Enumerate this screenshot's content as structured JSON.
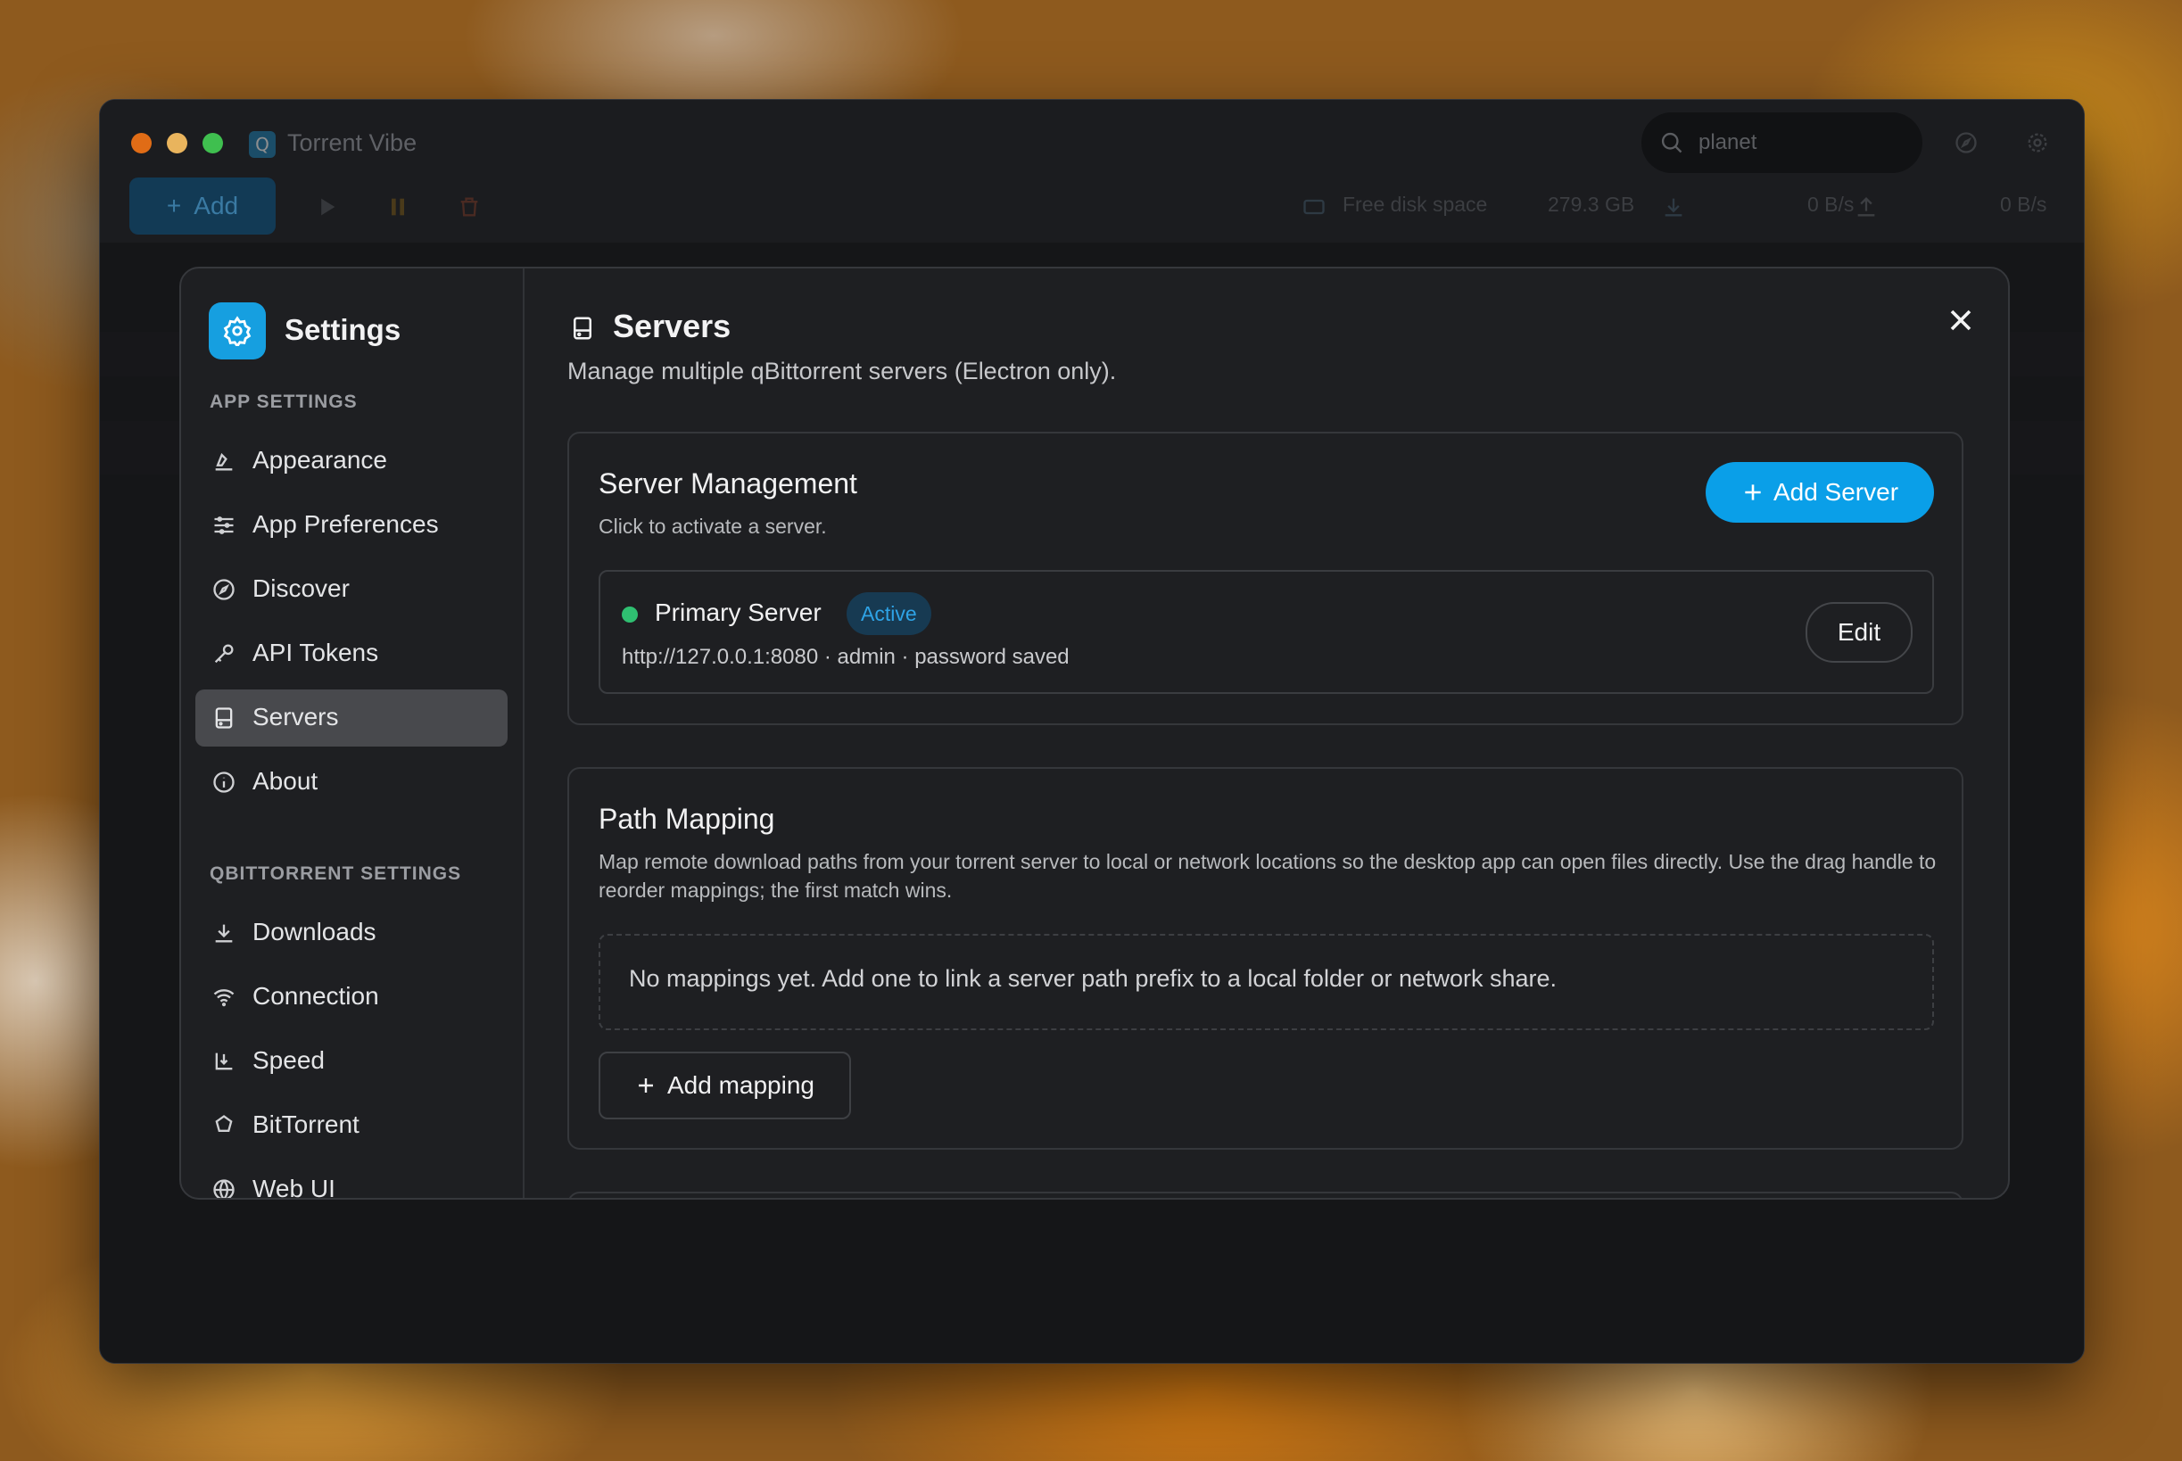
{
  "app": {
    "title": "Torrent Vibe",
    "search_value": "planet",
    "add_label": "Add",
    "free_disk_label": "Free disk space",
    "free_disk_value": "279.3 GB",
    "download_speed": "0 B/s",
    "upload_speed": "0 B/s"
  },
  "settings": {
    "title": "Settings",
    "app_section_label": "APP SETTINGS",
    "app_items": [
      {
        "label": "Appearance",
        "icon": "brush-icon"
      },
      {
        "label": "App Preferences",
        "icon": "sliders-icon"
      },
      {
        "label": "Discover",
        "icon": "compass-icon"
      },
      {
        "label": "API Tokens",
        "icon": "key-icon"
      },
      {
        "label": "Servers",
        "icon": "server-icon",
        "active": true
      },
      {
        "label": "About",
        "icon": "info-icon"
      }
    ],
    "qb_section_label": "QBITTORRENT SETTINGS",
    "qb_items": [
      {
        "label": "Downloads",
        "icon": "download-icon"
      },
      {
        "label": "Connection",
        "icon": "wifi-icon"
      },
      {
        "label": "Speed",
        "icon": "speed-icon"
      },
      {
        "label": "BitTorrent",
        "icon": "puzzle-icon"
      },
      {
        "label": "Web UI",
        "icon": "globe-icon"
      }
    ]
  },
  "servers_page": {
    "title": "Servers",
    "subtitle": "Manage multiple qBittorrent servers (Electron only).",
    "management": {
      "title": "Server Management",
      "subtitle": "Click to activate a server.",
      "add_button": "Add Server",
      "servers": [
        {
          "name": "Primary Server",
          "badge": "Active",
          "meta": "http://127.0.0.1:8080 · admin · password saved",
          "edit_label": "Edit",
          "status_color": "#2fbf71"
        }
      ]
    },
    "path_mapping": {
      "title": "Path Mapping",
      "description": "Map remote download paths from your torrent server to local or network locations so the desktop app can open files directly. Use the drag handle to reorder mappings; the first match wins.",
      "empty_text": "No mappings yet. Add one to link a server path prefix to a local folder or network share.",
      "add_button": "Add mapping"
    }
  },
  "colors": {
    "accent": "#0a9fe8",
    "active_nav_bg": "#48494d",
    "status_active": "#2fbf71"
  }
}
